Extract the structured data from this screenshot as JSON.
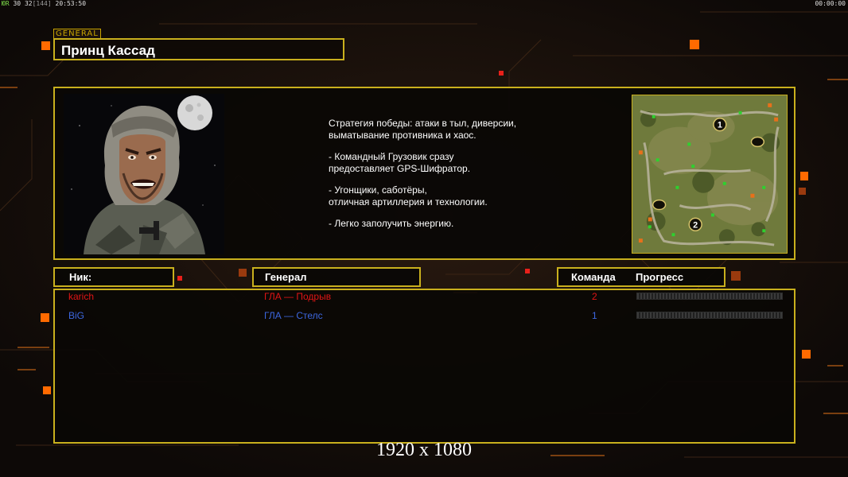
{
  "hud": {
    "tag": "ЮR",
    "n1": "30",
    "n2": "32",
    "n3": "[144]",
    "clock": "20:53:50",
    "timer": "00:00:00"
  },
  "general": {
    "tag": "GENERAL",
    "name": "Принц Кассад",
    "portrait": "gla-general-portrait",
    "strategy": [
      "Стратегия победы: атаки в тыл, диверсии,\n выматывание противника и хаос.",
      "- Командный Грузовик сразу\nпредоставляет GPS-Шифратор.",
      "- Угонщики, саботёры,\nотличная артиллерия и технологии.",
      "- Легко заполучить энергию."
    ]
  },
  "map": {
    "spawns": [
      "1",
      "2"
    ]
  },
  "table": {
    "headers": {
      "nick": "Ник:",
      "general": "Генерал",
      "team": "Команда",
      "progress": "Прогресс"
    },
    "players": [
      {
        "nick": "karich",
        "general": "ГЛА — Подрыв",
        "team": "2",
        "color": "#e01515",
        "progress": 0
      },
      {
        "nick": "BiG",
        "general": "ГЛА — Стелс",
        "team": "1",
        "color": "#3c67e0",
        "progress": 0
      }
    ]
  },
  "colors": {
    "frame": "#c9b01d",
    "accent": "#ff6a00"
  },
  "resolution": "1920 x 1080"
}
